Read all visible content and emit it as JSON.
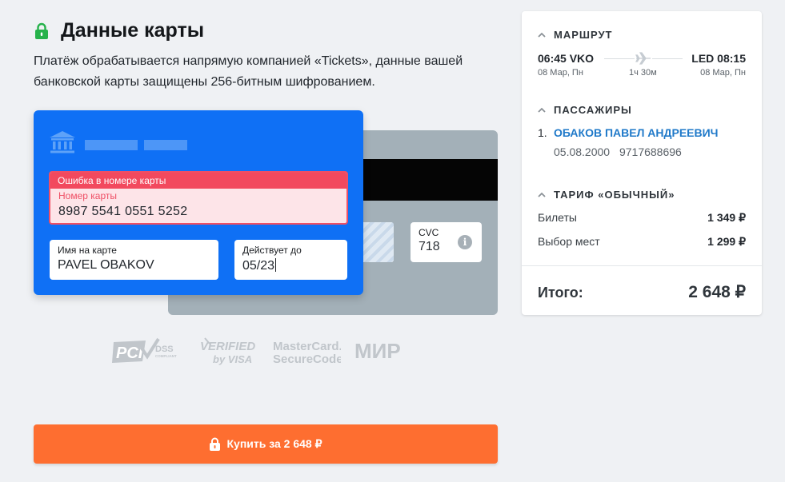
{
  "colors": {
    "accent_blue": "#0f70f5",
    "buy_orange": "#fe6e30",
    "secure_green": "#26b24b",
    "error_red": "#f2495e",
    "link_blue": "#1f79c9"
  },
  "header": {
    "icon": "lock-icon",
    "title": "Данные карты",
    "intro": "Платёж обрабатывается напрямую компанией «Tickets», данные вашей банковской карты защищены 256-битным шифрованием."
  },
  "card": {
    "bank_icon": "bank-icon",
    "number": {
      "error": "Ошибка в номере карты",
      "label": "Номер карты",
      "value": "8987 5541 0551 5252"
    },
    "holder": {
      "label": "Имя на карте",
      "value": "PAVEL OBAKOV"
    },
    "expiry": {
      "label": "Действует до",
      "value": "05/23"
    },
    "cvc": {
      "label": "CVC",
      "value": "718",
      "info_icon": "info-icon",
      "info_glyph": "i"
    }
  },
  "logos": [
    {
      "name": "pci-dss",
      "text": "PCI",
      "sub": "DSS",
      "sub2": "COMPLIANT"
    },
    {
      "name": "verified-by-visa",
      "text": "VERIFIED",
      "sub": "by VISA"
    },
    {
      "name": "mastercard-securecode",
      "text": "MasterCard.",
      "sub": "SecureCode."
    },
    {
      "name": "mir",
      "text": "МИР"
    }
  ],
  "buy_button": {
    "icon": "lock-icon",
    "label": "Купить за 2 648 ₽"
  },
  "summary": {
    "route": {
      "title": "МАРШРУТ",
      "departure": "06:45 VKO",
      "departure_date": "08 Мар, Пн",
      "arrival": "LED 08:15",
      "arrival_date": "08 Мар, Пн",
      "duration": "1ч 30м"
    },
    "passengers": {
      "title": "ПАССАЖИРЫ",
      "items": [
        {
          "index": "1.",
          "name": "ОБАКОВ ПАВЕЛ АНДРЕЕВИЧ",
          "birth": "05.08.2000",
          "doc": "9717688696"
        }
      ]
    },
    "fare": {
      "title": "ТАРИФ «ОБЫЧНЫЙ»",
      "rows": [
        {
          "label": "Билеты",
          "amount": "1 349 ₽"
        },
        {
          "label": "Выбор мест",
          "amount": "1 299 ₽"
        }
      ]
    },
    "total": {
      "label": "Итого:",
      "amount": "2 648 ₽"
    }
  }
}
